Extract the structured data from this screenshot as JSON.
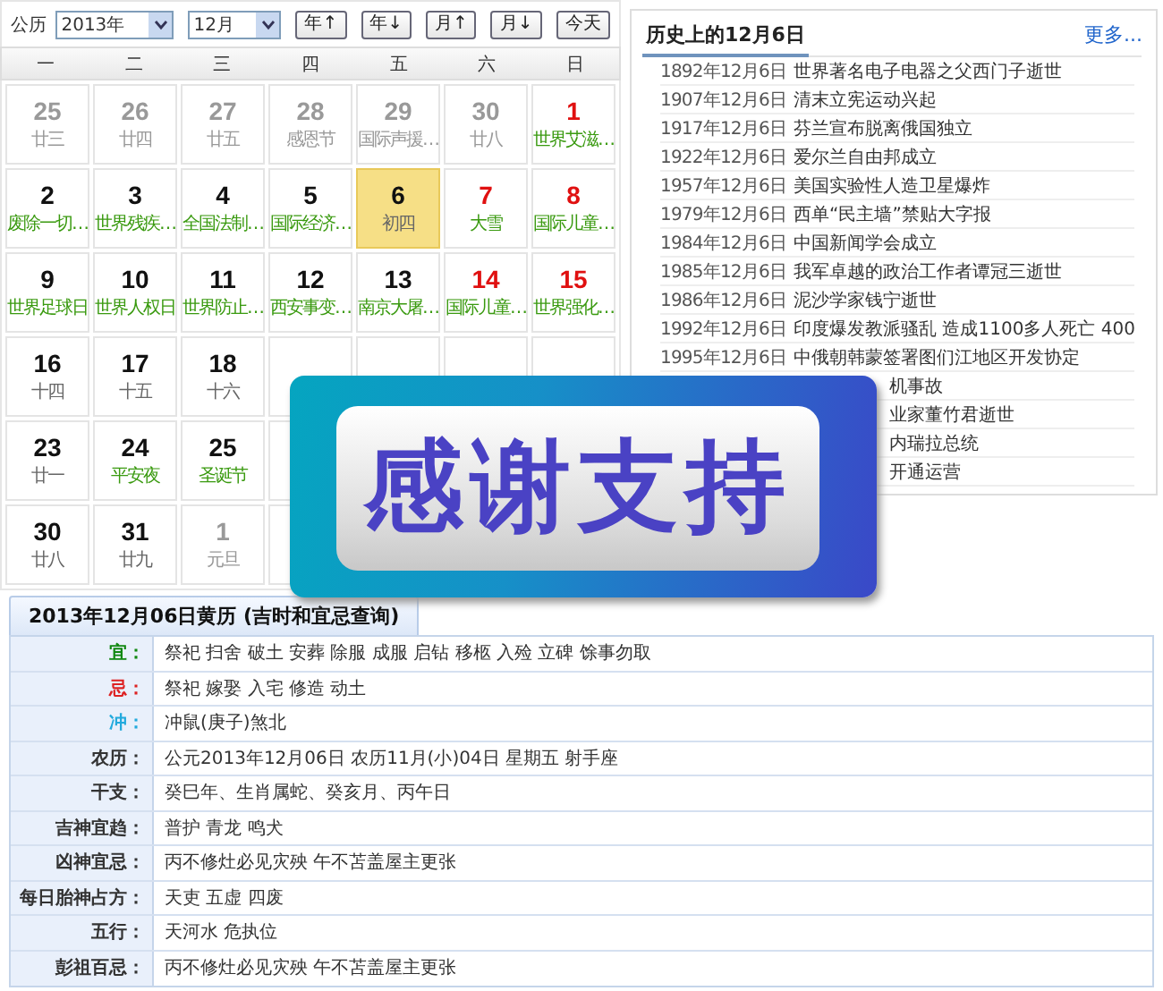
{
  "controls": {
    "calendar_label": "公历",
    "year": "2013年",
    "month": "12月",
    "buttons": [
      "年↑",
      "年↓",
      "月↑",
      "月↓",
      "今天"
    ]
  },
  "calendar": {
    "weekdays": [
      "一",
      "二",
      "三",
      "四",
      "五",
      "六",
      "日"
    ],
    "rows": [
      [
        {
          "kind": "day",
          "day": "25",
          "note": "廿三",
          "other_month": true,
          "weekend": false,
          "festival": false,
          "today": false
        },
        {
          "kind": "day",
          "day": "26",
          "note": "廿四",
          "other_month": true,
          "weekend": false,
          "festival": false,
          "today": false
        },
        {
          "kind": "day",
          "day": "27",
          "note": "廿五",
          "other_month": true,
          "weekend": false,
          "festival": false,
          "today": false
        },
        {
          "kind": "day",
          "day": "28",
          "note": "感恩节",
          "other_month": true,
          "weekend": false,
          "festival": true,
          "today": false
        },
        {
          "kind": "day",
          "day": "29",
          "note": "国际声援…",
          "other_month": true,
          "weekend": false,
          "festival": true,
          "today": false
        },
        {
          "kind": "day",
          "day": "30",
          "note": "廿八",
          "other_month": true,
          "weekend": false,
          "festival": false,
          "today": false
        },
        {
          "kind": "day",
          "day": "1",
          "note": "世界艾滋…",
          "other_month": false,
          "weekend": true,
          "festival": true,
          "today": false
        }
      ],
      [
        {
          "kind": "day",
          "day": "2",
          "note": "废除一切…",
          "other_month": false,
          "weekend": false,
          "festival": true,
          "today": false
        },
        {
          "kind": "day",
          "day": "3",
          "note": "世界残疾…",
          "other_month": false,
          "weekend": false,
          "festival": true,
          "today": false
        },
        {
          "kind": "day",
          "day": "4",
          "note": "全国法制…",
          "other_month": false,
          "weekend": false,
          "festival": true,
          "today": false
        },
        {
          "kind": "day",
          "day": "5",
          "note": "国际经济…",
          "other_month": false,
          "weekend": false,
          "festival": true,
          "today": false
        },
        {
          "kind": "day",
          "day": "6",
          "note": "初四",
          "other_month": false,
          "weekend": false,
          "festival": false,
          "today": true
        },
        {
          "kind": "day",
          "day": "7",
          "note": "大雪",
          "other_month": false,
          "weekend": true,
          "festival": true,
          "today": false
        },
        {
          "kind": "day",
          "day": "8",
          "note": "国际儿童…",
          "other_month": false,
          "weekend": true,
          "festival": true,
          "today": false
        }
      ],
      [
        {
          "kind": "day",
          "day": "9",
          "note": "世界足球日",
          "other_month": false,
          "weekend": false,
          "festival": true,
          "today": false
        },
        {
          "kind": "day",
          "day": "10",
          "note": "世界人权日",
          "other_month": false,
          "weekend": false,
          "festival": true,
          "today": false
        },
        {
          "kind": "day",
          "day": "11",
          "note": "世界防止…",
          "other_month": false,
          "weekend": false,
          "festival": true,
          "today": false
        },
        {
          "kind": "day",
          "day": "12",
          "note": "西安事变…",
          "other_month": false,
          "weekend": false,
          "festival": true,
          "today": false
        },
        {
          "kind": "day",
          "day": "13",
          "note": "南京大屠…",
          "other_month": false,
          "weekend": false,
          "festival": true,
          "today": false
        },
        {
          "kind": "day",
          "day": "14",
          "note": "国际儿童…",
          "other_month": false,
          "weekend": true,
          "festival": true,
          "today": false
        },
        {
          "kind": "day",
          "day": "15",
          "note": "世界强化…",
          "other_month": false,
          "weekend": true,
          "festival": true,
          "today": false
        }
      ],
      [
        {
          "kind": "day",
          "day": "16",
          "note": "十四",
          "other_month": false,
          "weekend": false,
          "festival": false,
          "today": false
        },
        {
          "kind": "day",
          "day": "17",
          "note": "十五",
          "other_month": false,
          "weekend": false,
          "festival": false,
          "today": false
        },
        {
          "kind": "day",
          "day": "18",
          "note": "十六",
          "other_month": false,
          "weekend": false,
          "festival": false,
          "today": false
        },
        {
          "kind": "covered"
        },
        {
          "kind": "covered"
        },
        {
          "kind": "covered"
        },
        {
          "kind": "covered"
        }
      ],
      [
        {
          "kind": "day",
          "day": "23",
          "note": "廿一",
          "other_month": false,
          "weekend": false,
          "festival": false,
          "today": false
        },
        {
          "kind": "day",
          "day": "24",
          "note": "平安夜",
          "other_month": false,
          "weekend": false,
          "festival": true,
          "today": false
        },
        {
          "kind": "day",
          "day": "25",
          "note": "圣诞节",
          "other_month": false,
          "weekend": false,
          "festival": true,
          "today": false
        },
        {
          "kind": "covered"
        },
        {
          "kind": "hidden"
        },
        {
          "kind": "hidden"
        },
        {
          "kind": "hidden"
        }
      ],
      [
        {
          "kind": "day",
          "day": "30",
          "note": "廿八",
          "other_month": false,
          "weekend": false,
          "festival": false,
          "today": false
        },
        {
          "kind": "day",
          "day": "31",
          "note": "廿九",
          "other_month": false,
          "weekend": false,
          "festival": false,
          "today": false
        },
        {
          "kind": "day",
          "day": "1",
          "note": "元旦",
          "other_month": true,
          "weekend": false,
          "festival": false,
          "today": false
        },
        {
          "kind": "covered"
        },
        {
          "kind": "hidden"
        },
        {
          "kind": "covered"
        },
        {
          "kind": "covered"
        }
      ]
    ]
  },
  "history": {
    "title": "历史上的12月6日",
    "more": "更多...",
    "items": [
      {
        "kind": "full",
        "date": "1892年12月6日",
        "text": "世界著名电子电器之父西门子逝世"
      },
      {
        "kind": "full",
        "date": "1907年12月6日",
        "text": "清末立宪运动兴起"
      },
      {
        "kind": "full",
        "date": "1917年12月6日",
        "text": "芬兰宣布脱离俄国独立"
      },
      {
        "kind": "full",
        "date": "1922年12月6日",
        "text": "爱尔兰自由邦成立"
      },
      {
        "kind": "full",
        "date": "1957年12月6日",
        "text": "美国实验性人造卫星爆炸"
      },
      {
        "kind": "full",
        "date": "1979年12月6日",
        "text": "西单“民主墙”禁贴大字报"
      },
      {
        "kind": "full",
        "date": "1984年12月6日",
        "text": "中国新闻学会成立"
      },
      {
        "kind": "full",
        "date": "1985年12月6日",
        "text": "我军卓越的政治工作者谭冠三逝世"
      },
      {
        "kind": "full",
        "date": "1986年12月6日",
        "text": "泥沙学家钱宁逝世"
      },
      {
        "kind": "full",
        "date": "1992年12月6日",
        "text": "印度爆发教派骚乱 造成1100多人死亡 400"
      },
      {
        "kind": "full",
        "date": "1995年12月6日",
        "text": "中俄朝韩蒙签署图们江地区开发协定"
      },
      {
        "kind": "cut",
        "text": "机事故"
      },
      {
        "kind": "cut",
        "text": "业家董竹君逝世"
      },
      {
        "kind": "cut",
        "text": "内瑞拉总统"
      },
      {
        "kind": "cut",
        "text": "开通运营"
      }
    ]
  },
  "almanac": {
    "tab": "2013年12月06日黄历 (吉时和宜忌查询)",
    "rows": [
      {
        "label": "宜：",
        "value": "祭祀 扫舍 破土 安葬 除服 成服 启钻 移柩 入殓 立碑 馀事勿取",
        "color": "#118811"
      },
      {
        "label": "忌：",
        "value": "祭祀 嫁娶 入宅 修造 动土",
        "color": "#dd2222"
      },
      {
        "label": "冲：",
        "value": "冲鼠(庚子)煞北",
        "color": "#22aadd"
      },
      {
        "label": "农历：",
        "value": "公元2013年12月06日 农历11月(小)04日 星期五 射手座",
        "color": "#333333"
      },
      {
        "label": "干支：",
        "value": "癸巳年、生肖属蛇、癸亥月、丙午日",
        "color": "#333333"
      },
      {
        "label": "吉神宜趋：",
        "value": "普护 青龙 鸣犬",
        "color": "#333333"
      },
      {
        "label": "凶神宜忌：",
        "value": "丙不修灶必见灾殃 午不苫盖屋主更张",
        "color": "#333333"
      },
      {
        "label": "每日胎神占方：",
        "value": "天吏 五虚 四废",
        "color": "#333333"
      },
      {
        "label": "五行：",
        "value": "天河水 危执位",
        "color": "#333333"
      },
      {
        "label": "彭祖百忌：",
        "value": "丙不修灶必见灾殃 午不苫盖屋主更张",
        "color": "#333333"
      }
    ]
  },
  "banner": {
    "text": "感谢支持"
  }
}
